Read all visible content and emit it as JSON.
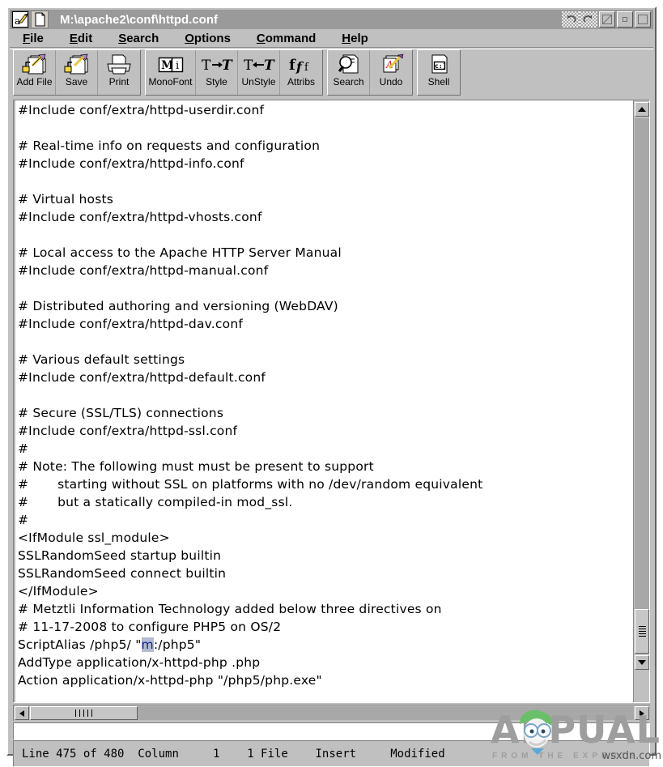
{
  "window": {
    "title": "M:\\apache2\\conf\\httpd.conf",
    "app_icon": "editor-pencil-icon",
    "doc_icon": "page-icon",
    "controls": [
      {
        "name": "undo-arrow-button",
        "glyph": "↶"
      },
      {
        "name": "redo-arrow-button",
        "glyph": "↷"
      },
      {
        "name": "hide-button",
        "glyph": ""
      },
      {
        "name": "minimize-button",
        "glyph": ""
      },
      {
        "name": "maximize-button",
        "glyph": ""
      }
    ]
  },
  "menu": {
    "items": [
      {
        "label": "File",
        "mnemonic": "F",
        "rest": "ile"
      },
      {
        "label": "Edit",
        "mnemonic": "E",
        "rest": "dit"
      },
      {
        "label": "Search",
        "mnemonic": "S",
        "rest": "earch"
      },
      {
        "label": "Options",
        "mnemonic": "O",
        "rest": "ptions"
      },
      {
        "label": "Command",
        "mnemonic": "C",
        "rest": "ommand"
      },
      {
        "label": "Help",
        "mnemonic": "H",
        "rest": "elp"
      }
    ]
  },
  "toolbar": {
    "groups": [
      {
        "buttons": [
          {
            "label": "Add File",
            "icon": "add-file-icon"
          },
          {
            "label": "Save",
            "icon": "save-icon"
          },
          {
            "label": "Print",
            "icon": "print-icon"
          }
        ]
      },
      {
        "buttons": [
          {
            "label": "MonoFont",
            "icon": "monofont-icon",
            "glyph": "M i"
          },
          {
            "label": "Style",
            "icon": "style-icon",
            "glyph": "T→T"
          },
          {
            "label": "UnStyle",
            "icon": "unstyle-icon",
            "glyph": "T←T"
          },
          {
            "label": "Attribs",
            "icon": "attribs-icon",
            "glyph": "fƒf"
          }
        ]
      },
      {
        "buttons": [
          {
            "label": "Search",
            "icon": "search-magnifier-icon"
          },
          {
            "label": "Undo",
            "icon": "undo-pencil-icon"
          }
        ]
      },
      {
        "buttons": [
          {
            "label": "Shell",
            "icon": "shell-prompt-icon",
            "glyph": "c:]"
          }
        ]
      }
    ]
  },
  "editor": {
    "lines_before_selection": "#Include conf/extra/httpd-userdir.conf\n\n# Real-time info on requests and configuration\n#Include conf/extra/httpd-info.conf\n\n# Virtual hosts\n#Include conf/extra/httpd-vhosts.conf\n\n# Local access to the Apache HTTP Server Manual\n#Include conf/extra/httpd-manual.conf\n\n# Distributed authoring and versioning (WebDAV)\n#Include conf/extra/httpd-dav.conf\n\n# Various default settings\n#Include conf/extra/httpd-default.conf\n\n# Secure (SSL/TLS) connections\n#Include conf/extra/httpd-ssl.conf\n#\n# Note: The following must must be present to support\n#       starting without SSL on platforms with no /dev/random equivalent\n#       but a statically compiled-in mod_ssl.\n#\n<IfModule ssl_module>\nSSLRandomSeed startup builtin\nSSLRandomSeed connect builtin\n</IfModule>\n# Metztli Information Technology added below three directives on\n# 11-17-2008 to configure PHP5 on OS/2\nScriptAlias /php5/ \"",
    "selection": "m",
    "lines_after_selection": ":/php5\"\nAddType application/x-httpd-php .php\nAction application/x-httpd-php \"/php5/php.exe\"",
    "selection_color": "#b3bcd0",
    "selection_text_color": "#10209a"
  },
  "command_line": {
    "value": "",
    "placeholder": ""
  },
  "status_bar": {
    "line_label": "Line 475 of 480",
    "column_label": "Column",
    "column_value": "1",
    "file_count": "1 File",
    "mode": "Insert",
    "modified": "Modified"
  },
  "scrollbars": {
    "vertical": {
      "up_glyph": "▲",
      "down_glyph": "▼",
      "thumb_position": "bottom"
    },
    "horizontal": {
      "left_glyph": "◀",
      "right_glyph": "▶",
      "thumb_position": "left"
    }
  },
  "watermark": {
    "brand": "APPUALS",
    "tagline": "FROM THE EXPERTS",
    "site": "wsxdn.com",
    "color": "#9e9e9e"
  }
}
